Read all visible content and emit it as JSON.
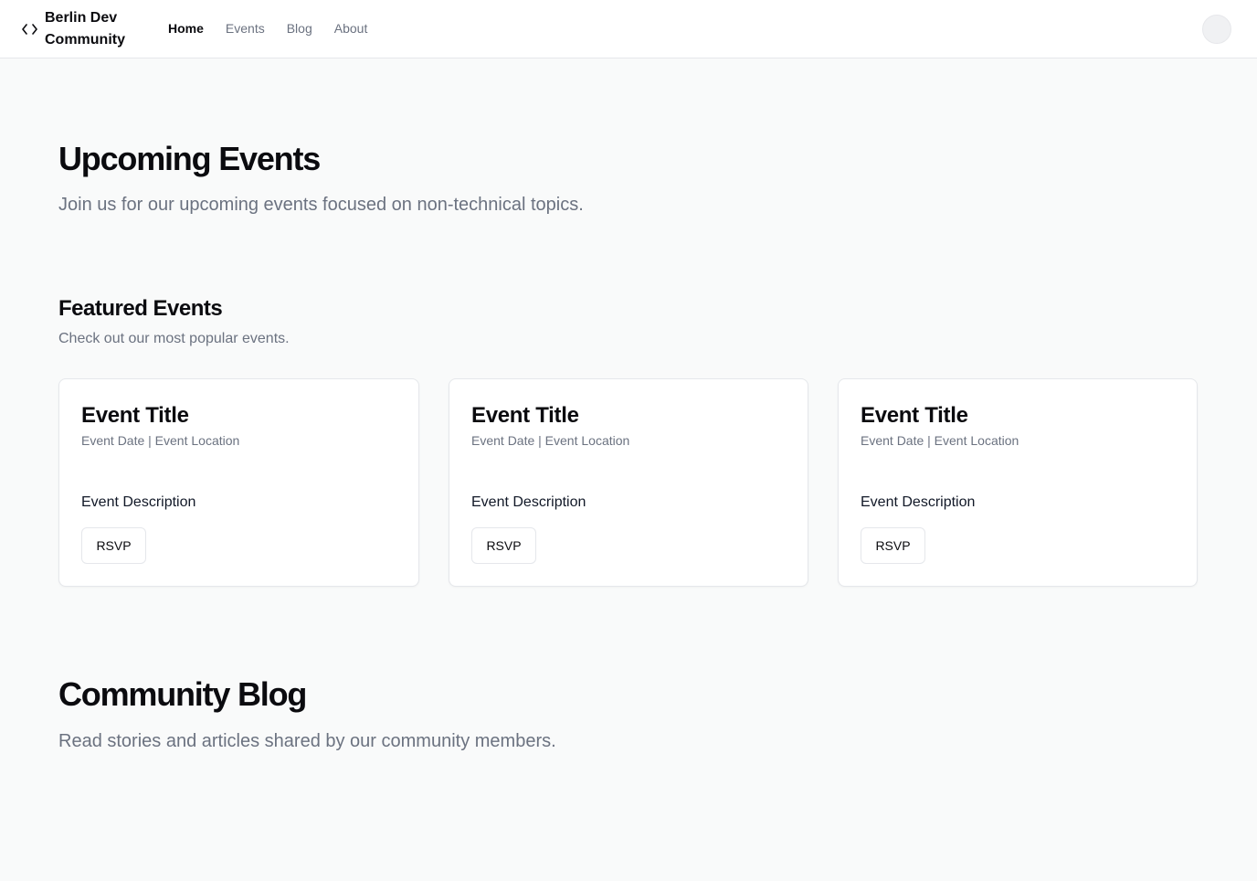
{
  "header": {
    "brand": "Berlin Dev Community",
    "nav": [
      "Home",
      "Events",
      "Blog",
      "About"
    ],
    "active_nav": "Home"
  },
  "hero": {
    "title": "Upcoming Events",
    "subtitle": "Join us for our upcoming events focused on non-technical topics."
  },
  "featured": {
    "title": "Featured Events",
    "subtitle": "Check out our most popular events.",
    "cards": [
      {
        "title": "Event Title",
        "meta": "Event Date | Event Location",
        "description": "Event Description",
        "button": "RSVP"
      },
      {
        "title": "Event Title",
        "meta": "Event Date | Event Location",
        "description": "Event Description",
        "button": "RSVP"
      },
      {
        "title": "Event Title",
        "meta": "Event Date | Event Location",
        "description": "Event Description",
        "button": "RSVP"
      }
    ]
  },
  "blog": {
    "title": "Community Blog",
    "subtitle": "Read stories and articles shared by our community members."
  },
  "icons": {
    "brand": "code-icon",
    "avatar": "user-avatar"
  },
  "colors": {
    "background": "#f9fafa",
    "text_primary": "#0b0b0f",
    "text_muted": "#6b7280",
    "border": "#e5e7eb"
  }
}
